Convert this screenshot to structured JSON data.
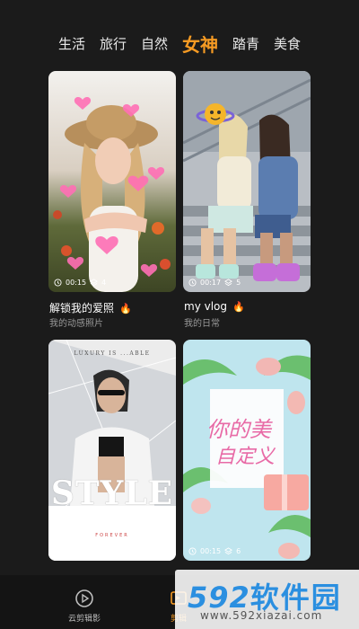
{
  "tabs": [
    "生活",
    "旅行",
    "自然",
    "女神",
    "踏青",
    "美食"
  ],
  "active_tab": "女神",
  "cards": [
    {
      "title": "解锁我的爱照",
      "subtitle": "我的动感照片",
      "duration": "00:15",
      "clips": "4",
      "hot": true
    },
    {
      "title": "my vlog",
      "subtitle": "我的日常",
      "duration": "00:17",
      "clips": "5",
      "hot": true
    },
    {
      "overlay_top": "LUXURY IS ...ABLE",
      "overlay_big": "STYLE",
      "overlay_small": "FOREVER"
    },
    {
      "overlay_text1": "你的美",
      "overlay_text2": "自定义",
      "duration": "00:15",
      "clips": "6"
    }
  ],
  "bottom_nav": [
    {
      "label": "云剪辑影",
      "icon": "play-circle-icon"
    },
    {
      "label": "剪辑",
      "icon": "film-icon"
    }
  ],
  "watermark": {
    "logo_num": "592",
    "logo_text": "软件园",
    "url": "www.592xiazai.com"
  },
  "colors": {
    "accent": "#f59a23",
    "bg": "#1b1b1b"
  }
}
